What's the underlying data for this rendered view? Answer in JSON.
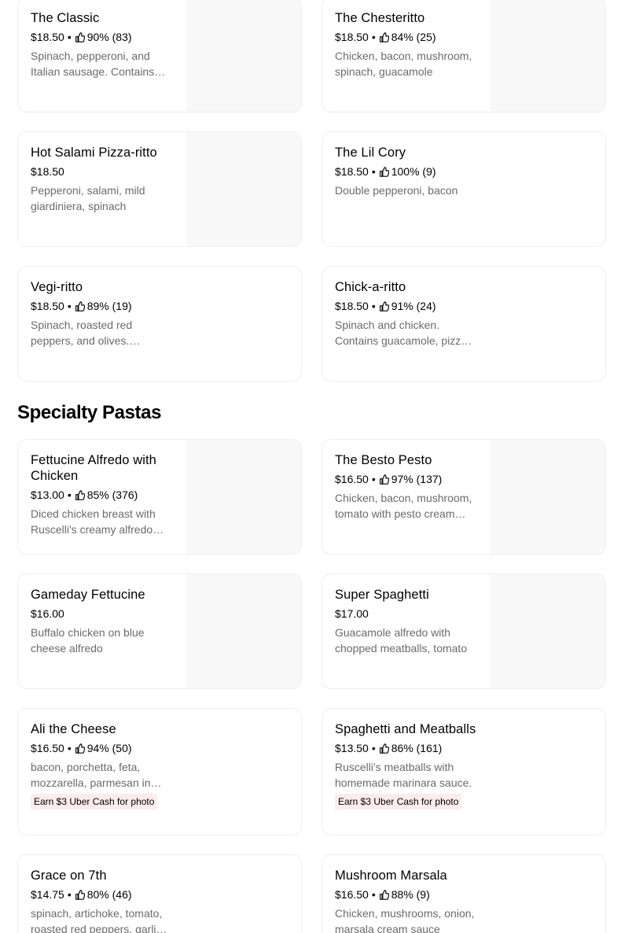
{
  "section_title": "Specialty Pastas",
  "top_items": [
    {
      "name": "The Classic",
      "price": "$18.50",
      "rating": "90% (83)",
      "desc": "Spinach, pepperoni, and Italian sausage. Contains guacamole, pizza sauce",
      "has_image": true
    },
    {
      "name": "The Chesteritto",
      "price": "$18.50",
      "rating": "84% (25)",
      "desc": "Chicken, bacon, mushroom, spinach, guacamole",
      "has_image": true
    },
    {
      "name": "Hot Salami Pizza-ritto",
      "price": "$18.50",
      "rating": "",
      "desc": "Pepperoni, salami, mild giardiniera, spinach",
      "has_image": true
    },
    {
      "name": "The Lil Cory",
      "price": "$18.50",
      "rating": "100% (9)",
      "desc": "Double pepperoni, bacon",
      "has_image": false
    },
    {
      "name": "Vegi-ritto",
      "price": "$18.50",
      "rating": "89% (19)",
      "desc": "Spinach, roasted red peppers, and olives. Contains guacamole",
      "has_image": false
    },
    {
      "name": "Chick-a-ritto",
      "price": "$18.50",
      "rating": "91% (24)",
      "desc": "Spinach and chicken. Contains guacamole, pizza sauce",
      "has_image": false
    }
  ],
  "pasta_items": [
    {
      "name": "Fettucine Alfredo with Chicken",
      "price": "$13.00",
      "rating": "85% (376)",
      "desc": "Diced chicken breast with Ruscelli's creamy alfredo sauce",
      "has_image": true,
      "promo": ""
    },
    {
      "name": "The Besto Pesto",
      "price": "$16.50",
      "rating": "97% (137)",
      "desc": "Chicken, bacon, mushroom, tomato with pesto cream sauce",
      "has_image": true,
      "promo": ""
    },
    {
      "name": "Gameday Fettucine",
      "price": "$16.00",
      "rating": "",
      "desc": "Buffalo chicken on blue cheese alfredo",
      "has_image": true,
      "promo": ""
    },
    {
      "name": "Super Spaghetti",
      "price": "$17.00",
      "rating": "",
      "desc": "Guacamole alfredo with chopped meatballs, tomato",
      "has_image": true,
      "promo": ""
    },
    {
      "name": "Ali the Cheese",
      "price": "$16.50",
      "rating": "94% (50)",
      "desc": "bacon, porchetta, feta, mozzarella, parmesan in alfredo sauce",
      "has_image": false,
      "promo": "Earn $3 Uber Cash for photo"
    },
    {
      "name": "Spaghetti and Meatballs",
      "price": "$13.50",
      "rating": "86% (161)",
      "desc": "Ruscelli's meatballs with homemade marinara sauce.",
      "has_image": false,
      "promo": "Earn $3 Uber Cash for photo"
    },
    {
      "name": "Grace on 7th",
      "price": "$14.75",
      "rating": "80% (46)",
      "desc": "spinach, artichoke, tomato, roasted red peppers, garlic alfredo",
      "has_image": false,
      "promo": ""
    },
    {
      "name": "Mushroom Marsala",
      "price": "$16.50",
      "rating": "88% (9)",
      "desc": "Chicken, mushrooms, onion, marsala cream sauce",
      "has_image": false,
      "promo": ""
    }
  ],
  "icons": {
    "rating": "thumbs-up-icon"
  },
  "colors": {
    "promo_bg": "#fdecec",
    "desc_text": "#6b6b6b",
    "thumb_bg": "#f8f8f8"
  }
}
